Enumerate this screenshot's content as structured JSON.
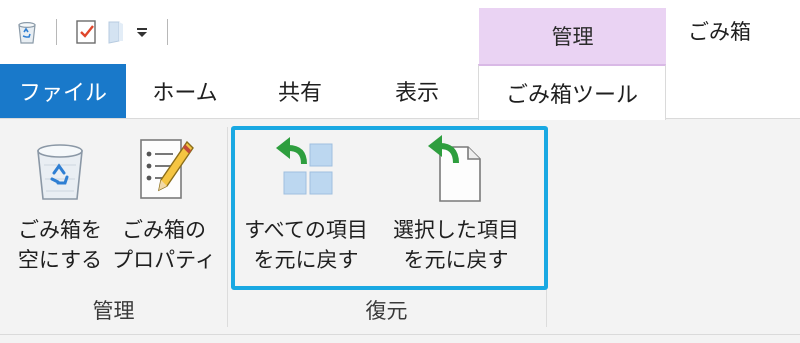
{
  "window": {
    "title": "ごみ箱"
  },
  "context": {
    "label": "管理"
  },
  "tabs": [
    {
      "label": "ファイル"
    },
    {
      "label": "ホーム"
    },
    {
      "label": "共有"
    },
    {
      "label": "表示"
    },
    {
      "label": "ごみ箱ツール"
    }
  ],
  "ribbon": {
    "buttons": [
      {
        "line1": "ごみ箱を",
        "line2": "空にする",
        "icon": "recycle-bin-icon"
      },
      {
        "line1": "ごみ箱の",
        "line2": "プロパティ",
        "icon": "properties-icon"
      },
      {
        "line1": "すべての項目",
        "line2": "を元に戻す",
        "icon": "restore-all-icon"
      },
      {
        "line1": "選択した項目",
        "line2": "を元に戻す",
        "icon": "restore-selected-icon"
      }
    ],
    "groups": [
      {
        "label": "管理"
      },
      {
        "label": "復元"
      }
    ]
  },
  "colors": {
    "file_tab": "#1979ca",
    "context_band": "#ead3f3",
    "highlight": "#19a8e2",
    "restore_arrow": "#2e9e3e"
  }
}
